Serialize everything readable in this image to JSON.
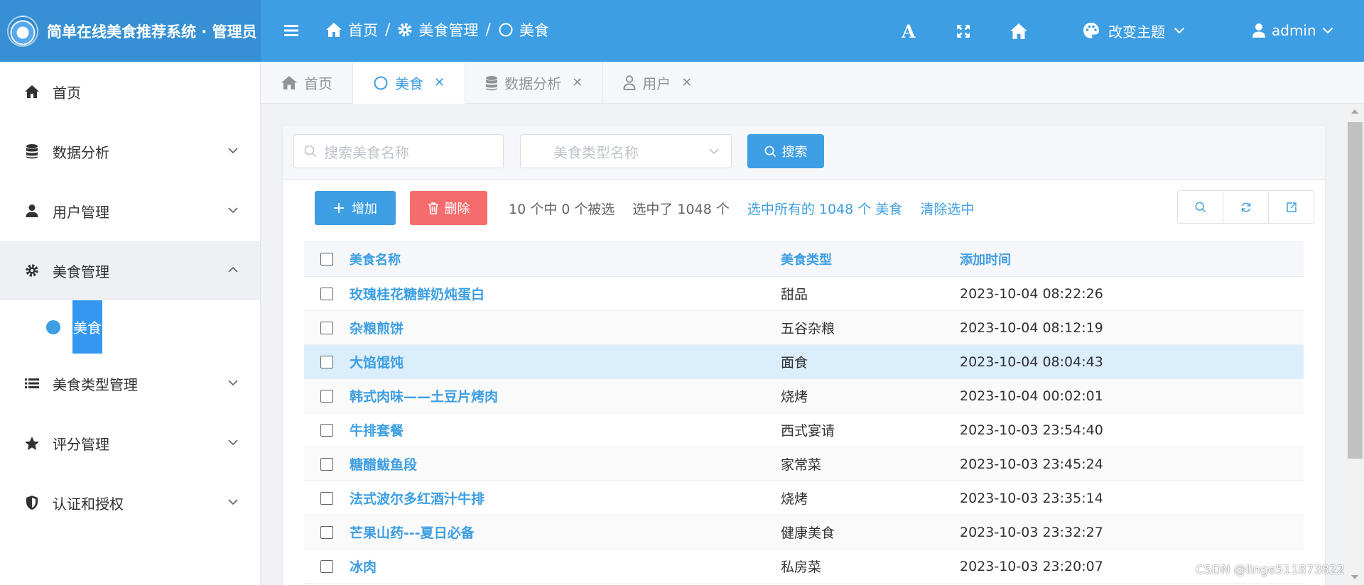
{
  "header": {
    "brand_title": "简单在线美食推荐系统 · 管理员",
    "breadcrumb": [
      "首页",
      "美食管理",
      "美食"
    ],
    "theme_label": "改变主题",
    "user_label": "admin",
    "font_icon_glyph": "A",
    "icons": [
      "hamburger-icon",
      "font-size-icon",
      "fullscreen-icon",
      "home-icon",
      "palette-icon",
      "user-icon"
    ]
  },
  "sidebar": {
    "items": [
      {
        "label": "首页",
        "icon": "home-icon"
      },
      {
        "label": "数据分析",
        "icon": "database-icon"
      },
      {
        "label": "用户管理",
        "icon": "user-icon"
      },
      {
        "label": "美食管理",
        "icon": "gear-icon"
      },
      {
        "label": "美食类型管理",
        "icon": "list-icon"
      },
      {
        "label": "评分管理",
        "icon": "star-icon"
      },
      {
        "label": "认证和授权",
        "icon": "shield-icon"
      }
    ],
    "submenu_active": "美食"
  },
  "tabs": [
    {
      "label": "首页"
    },
    {
      "label": "美食"
    },
    {
      "label": "数据分析"
    },
    {
      "label": "用户"
    }
  ],
  "search": {
    "name_placeholder": "搜索美食名称",
    "type_placeholder": "美食类型名称",
    "button_label": "搜索"
  },
  "actions": {
    "add_label": "增加",
    "delete_label": "删除",
    "count_text": "10 个中 0 个被选",
    "selected_text": "选中了 1048 个",
    "select_all_text": "选中所有的 1048 个 美食",
    "clear_text": "清除选中"
  },
  "table": {
    "headers": {
      "name": "美食名称",
      "type": "美食类型",
      "time": "添加时间"
    },
    "rows": [
      {
        "name": "玫瑰桂花糖鲜奶炖蛋白",
        "type": "甜品",
        "time": "2023-10-04 08:22:26"
      },
      {
        "name": "杂粮煎饼",
        "type": "五谷杂粮",
        "time": "2023-10-04 08:12:19"
      },
      {
        "name": "大馅馄饨",
        "type": "面食",
        "time": "2023-10-04 08:04:43"
      },
      {
        "name": "韩式肉味——土豆片烤肉",
        "type": "烧烤",
        "time": "2023-10-04 00:02:01"
      },
      {
        "name": "牛排套餐",
        "type": "西式宴请",
        "time": "2023-10-03 23:54:40"
      },
      {
        "name": "糖醋鲅鱼段",
        "type": "家常菜",
        "time": "2023-10-03 23:45:24"
      },
      {
        "name": "法式波尔多红酒汁牛排",
        "type": "烧烤",
        "time": "2023-10-03 23:35:14"
      },
      {
        "name": "芒果山药---夏日必备",
        "type": "健康美食",
        "time": "2023-10-03 23:32:27"
      },
      {
        "name": "冰肉",
        "type": "私房菜",
        "time": "2023-10-03 23:20:07"
      }
    ]
  },
  "watermark": "CSDN @linge511873822",
  "colors": {
    "primary": "#3d9ee3",
    "danger": "#f56c6c",
    "highlight_row": "#dbeefb"
  }
}
